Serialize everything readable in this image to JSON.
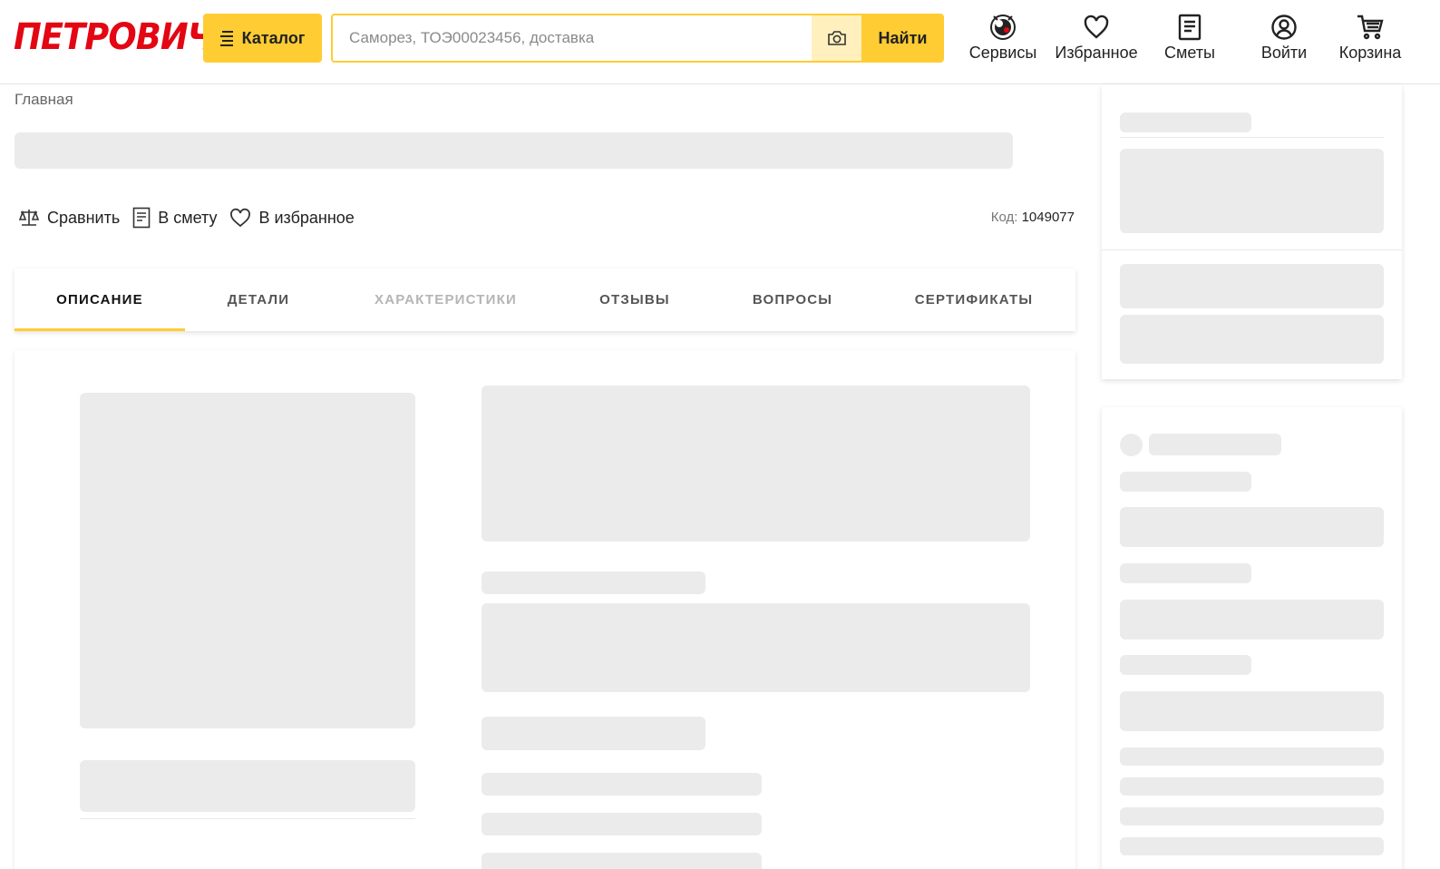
{
  "header": {
    "logo": "ПЕТРОВИЧ",
    "catalog_label": "Каталог",
    "search_placeholder": "Саморез, ТОЭ00023456, доставка",
    "search_value": "",
    "find_label": "Найти",
    "nav": [
      {
        "label": "Сервисы",
        "icon": "services-icon"
      },
      {
        "label": "Избранное",
        "icon": "heart-icon"
      },
      {
        "label": "Сметы",
        "icon": "document-icon"
      },
      {
        "label": "Войти",
        "icon": "user-icon"
      },
      {
        "label": "Корзина",
        "icon": "cart-icon"
      }
    ]
  },
  "breadcrumb": "Главная",
  "actions": {
    "compare": "Сравнить",
    "estimate": "В смету",
    "favorite": "В избранное"
  },
  "code": {
    "label": "Код:",
    "value": "1049077"
  },
  "tabs": [
    {
      "label": "ОПИСАНИЕ",
      "state": "active"
    },
    {
      "label": "ДЕТАЛИ",
      "state": "normal"
    },
    {
      "label": "ХАРАКТЕРИСТИКИ",
      "state": "disabled"
    },
    {
      "label": "ОТЗЫВЫ",
      "state": "normal"
    },
    {
      "label": "ВОПРОСЫ",
      "state": "normal"
    },
    {
      "label": "СЕРТИФИКАТЫ",
      "state": "normal"
    }
  ],
  "colors": {
    "brand_red": "#e30613",
    "accent_yellow": "#ffcc33",
    "skeleton": "#ebebeb"
  }
}
